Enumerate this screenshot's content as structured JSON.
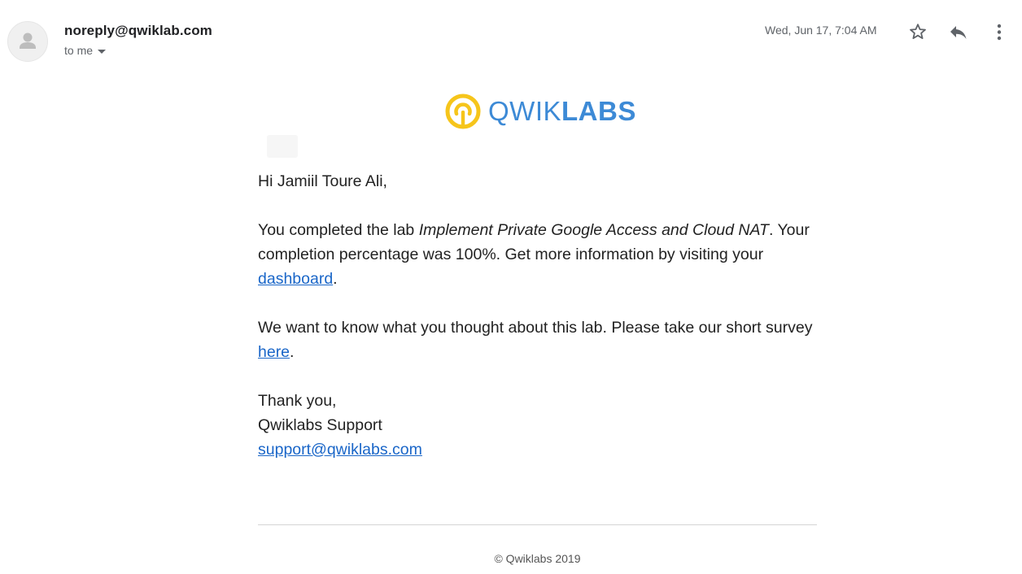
{
  "header": {
    "sender": "noreply@qwiklab.com",
    "recipient": "to me",
    "timestamp": "Wed, Jun 17, 7:04 AM"
  },
  "icons": {
    "avatar": "person-icon",
    "star": "star-outline-icon",
    "reply": "reply-icon",
    "more": "more-vertical-icon"
  },
  "logo": {
    "text_regular": "QWIK",
    "text_bold": "LABS",
    "colors": {
      "ring": "#f6c51b",
      "text": "#3d8ad6"
    }
  },
  "email": {
    "greeting": "Hi Jamiil Toure Ali,",
    "completion_prefix": "You completed the lab ",
    "lab_name": "Implement Private Google Access and Cloud NAT",
    "completion_suffix": ". Your completion percentage was 100%. Get more information by visiting your ",
    "dashboard_link": "dashboard",
    "period": ".",
    "survey_prefix": "We want to know what you thought about this lab. Please take our short survey ",
    "survey_link": "here",
    "signoff": "Thank you,",
    "signature_name": "Qwiklabs Support",
    "support_email": "support@qwiklabs.com"
  },
  "footer": {
    "copyright": "© Qwiklabs 2019"
  },
  "colors": {
    "link": "#1a66c8",
    "text": "#222222",
    "muted": "#5f6368"
  }
}
